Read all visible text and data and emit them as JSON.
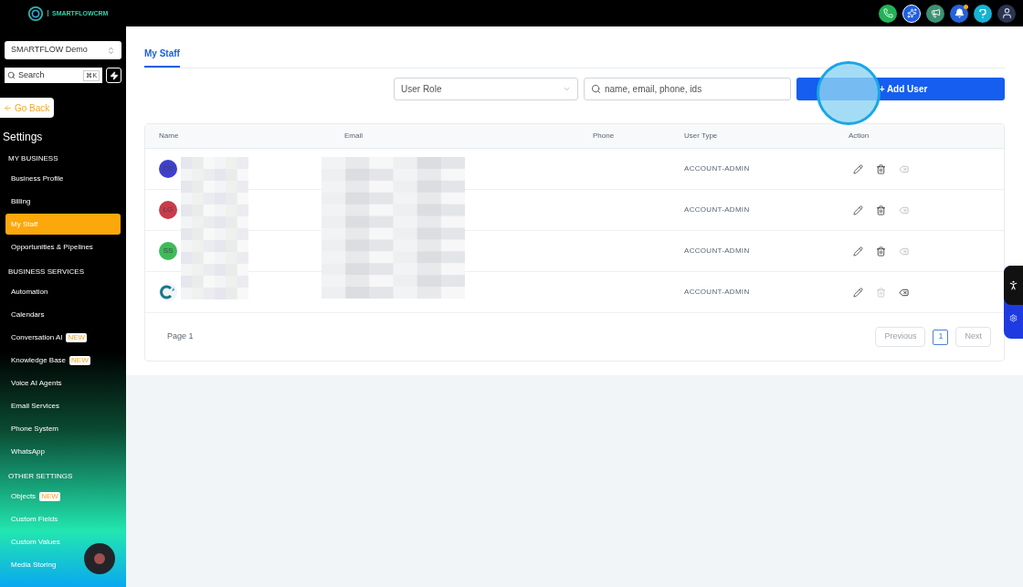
{
  "brand": {
    "name": "SMARTFLOWCRM"
  },
  "sidebar": {
    "account": "SMARTFLOW Demo",
    "search": {
      "placeholder": "Search",
      "shortcut": "⌘K"
    },
    "back": "Go Back",
    "title": "Settings",
    "sections": [
      {
        "heading": "MY BUSINESS",
        "items": [
          {
            "label": "Business Profile",
            "selected": false
          },
          {
            "label": "Billing",
            "selected": false
          },
          {
            "label": "My Staff",
            "selected": true
          },
          {
            "label": "Opportunities & Pipelines",
            "selected": false
          }
        ]
      },
      {
        "heading": "BUSINESS SERVICES",
        "items": [
          {
            "label": "Automation",
            "selected": false
          },
          {
            "label": "Calendars",
            "selected": false
          },
          {
            "label": "Conversation AI",
            "badge": "NEW",
            "selected": false
          },
          {
            "label": "Knowledge Base",
            "badge": "NEW",
            "selected": false
          },
          {
            "label": "Voice AI Agents",
            "selected": false
          },
          {
            "label": "Email Services",
            "selected": false
          },
          {
            "label": "Phone System",
            "selected": false
          },
          {
            "label": "WhatsApp",
            "selected": false
          }
        ]
      },
      {
        "heading": "OTHER SETTINGS",
        "items": [
          {
            "label": "Objects",
            "badge": "NEW",
            "selected": false
          },
          {
            "label": "Custom Fields",
            "selected": false
          },
          {
            "label": "Custom Values",
            "selected": false
          },
          {
            "label": "Media Storing",
            "selected": false
          }
        ]
      }
    ]
  },
  "tabs": [
    {
      "label": "My Staff",
      "selected": true
    }
  ],
  "filters": {
    "role_placeholder": "User Role",
    "search_placeholder": "name, email, phone, ids",
    "add_button": "+ Add User"
  },
  "table": {
    "columns": [
      "Name",
      "Email",
      "Phone",
      "User Type",
      "Action"
    ],
    "rows": [
      {
        "avatar": {
          "kind": "initials",
          "text": "CC",
          "color": "#3f3fcf"
        },
        "user_type": "ACCOUNT-ADMIN",
        "delete_disabled": false,
        "deactivate_disabled": true
      },
      {
        "avatar": {
          "kind": "initials",
          "text": "LG",
          "color": "#c83c4b"
        },
        "user_type": "ACCOUNT-ADMIN",
        "delete_disabled": false,
        "deactivate_disabled": true
      },
      {
        "avatar": {
          "kind": "initials",
          "text": "SS",
          "color": "#3dbb5a"
        },
        "user_type": "ACCOUNT-ADMIN",
        "delete_disabled": false,
        "deactivate_disabled": true
      },
      {
        "avatar": {
          "kind": "logo"
        },
        "user_type": "ACCOUNT-ADMIN",
        "delete_disabled": true,
        "deactivate_disabled": false
      }
    ]
  },
  "pagination": {
    "page_label": "Page 1",
    "previous": "Previous",
    "next": "Next",
    "pages": [
      {
        "label": "1",
        "selected": true
      }
    ]
  }
}
